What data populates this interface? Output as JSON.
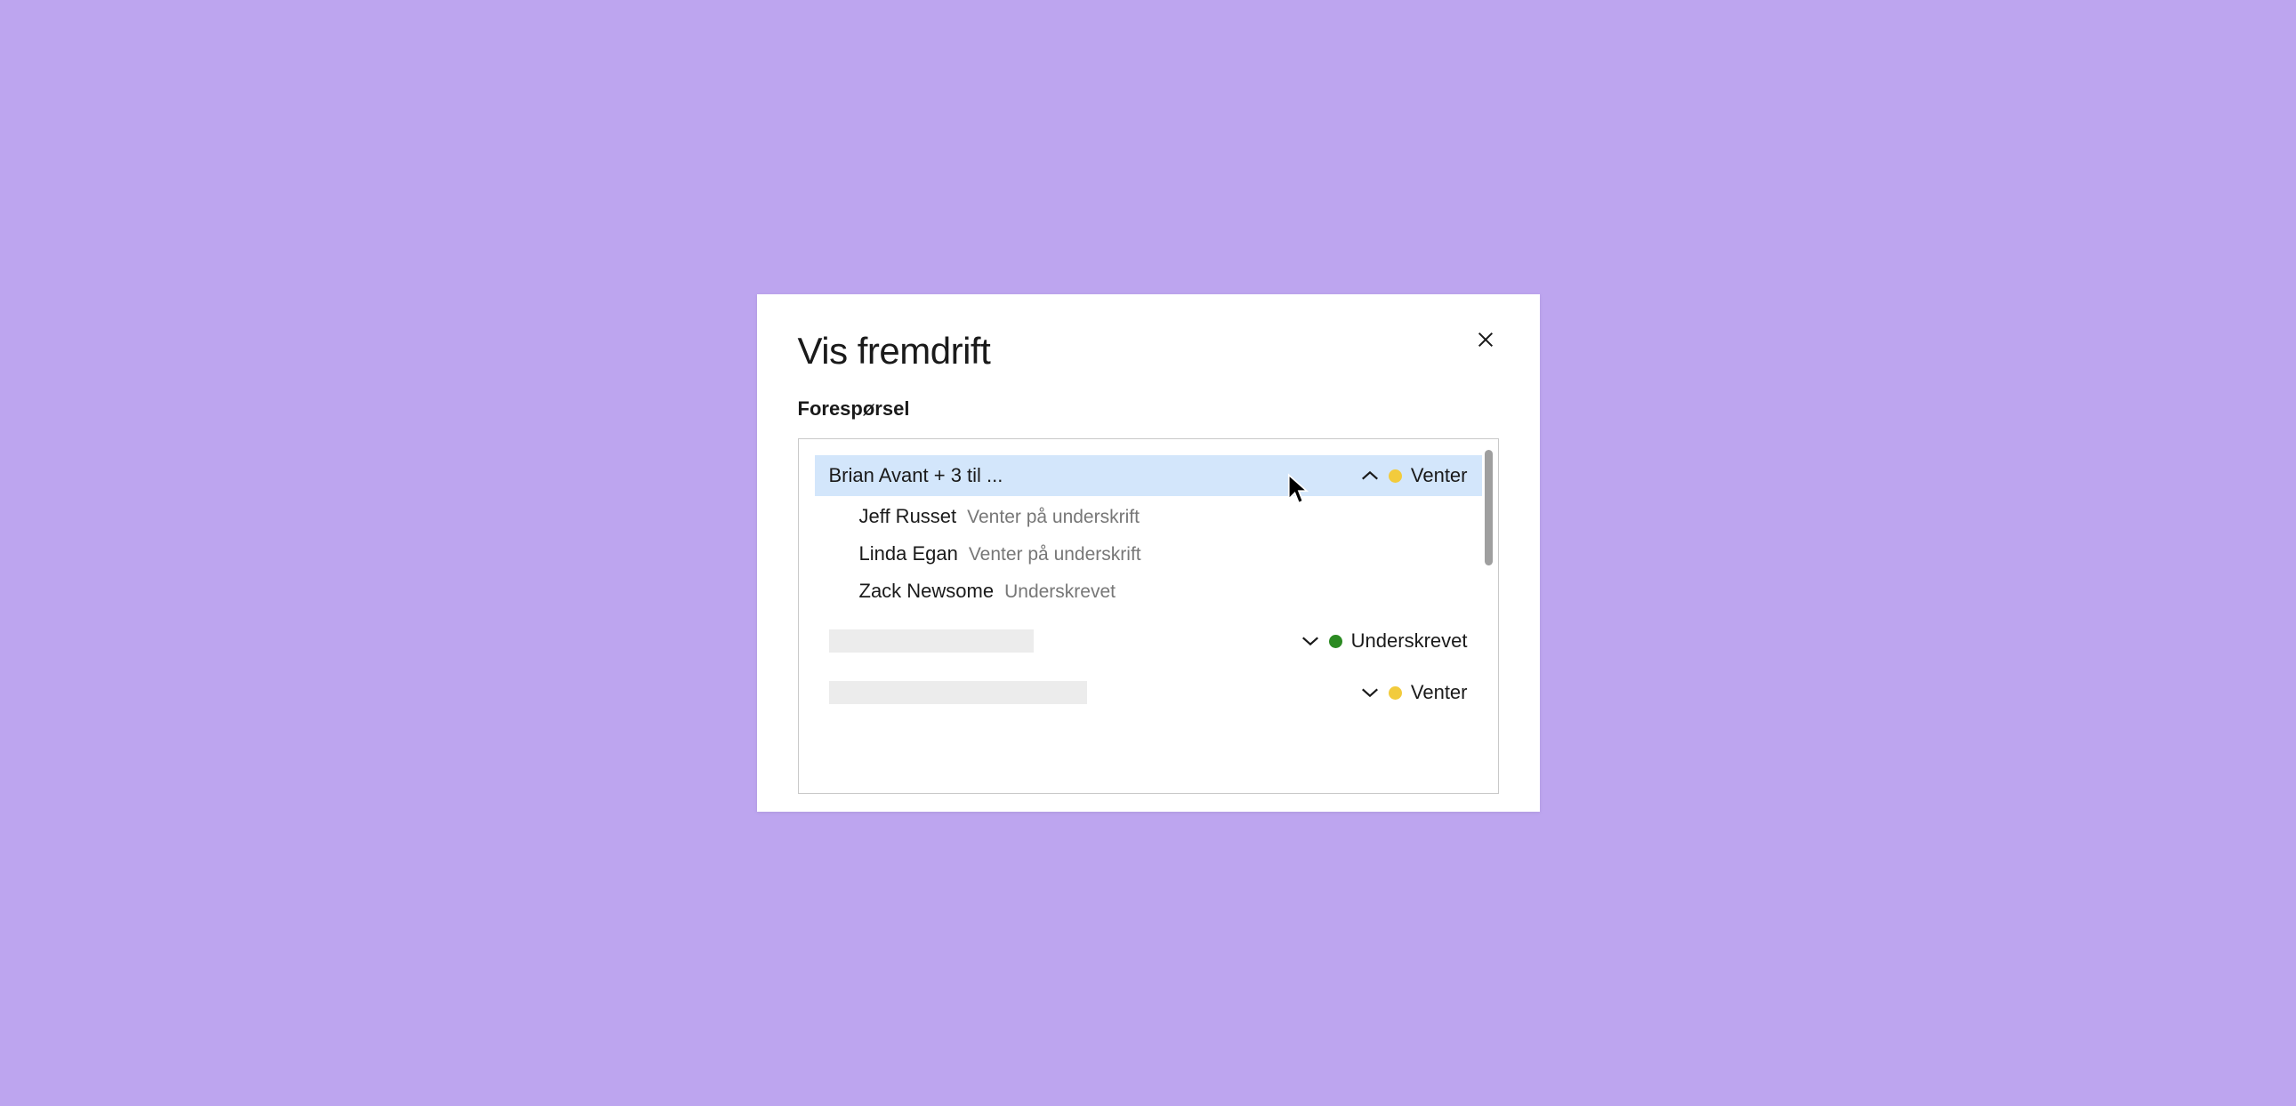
{
  "modal": {
    "title": "Vis fremdrift",
    "section_label": "Forespørsel"
  },
  "request": {
    "summary": "Brian Avant + 3 til ...",
    "status_label": "Venter",
    "status_color": "yellow",
    "expanded": true,
    "signers": [
      {
        "name": "Jeff Russet",
        "status": "Venter på underskrift"
      },
      {
        "name": "Linda Egan",
        "status": "Venter på underskrift"
      },
      {
        "name": "Zack Newsome",
        "status": "Underskrevet"
      }
    ]
  },
  "collapsed_rows": [
    {
      "status_label": "Underskrevet",
      "status_color": "green"
    },
    {
      "status_label": "Venter",
      "status_color": "yellow"
    }
  ]
}
